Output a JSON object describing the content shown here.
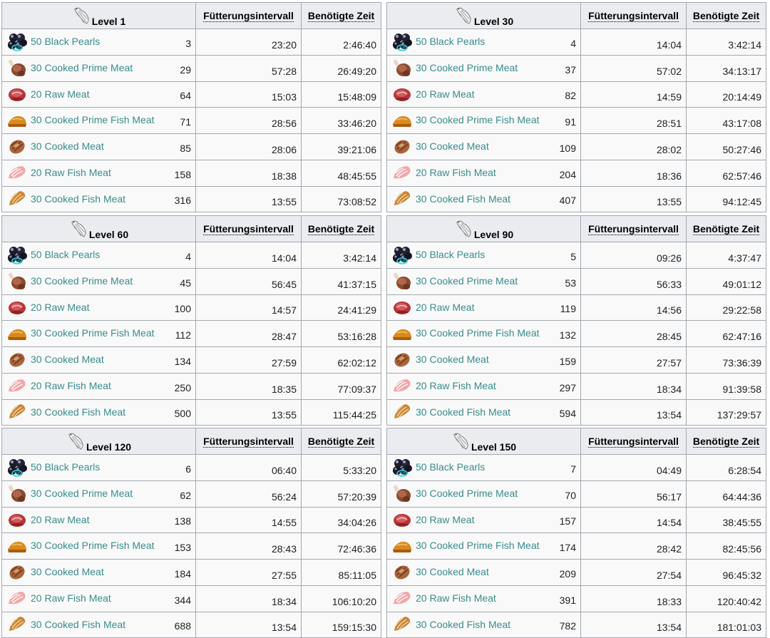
{
  "headers": {
    "interval": "Fütterungsintervall",
    "time": "Benötigte Zeit"
  },
  "tables": [
    {
      "level": "Level 1",
      "rows": [
        {
          "item": "50 Black Pearls",
          "icon": "black-pearls-icon",
          "qty": "3",
          "interval": "23:20",
          "time": "2:46:40"
        },
        {
          "item": "30 Cooked Prime Meat",
          "icon": "cooked-prime-meat-icon",
          "qty": "29",
          "interval": "57:28",
          "time": "26:49:20"
        },
        {
          "item": "20 Raw Meat",
          "icon": "raw-meat-icon",
          "qty": "64",
          "interval": "15:03",
          "time": "15:48:09"
        },
        {
          "item": "30 Cooked Prime Fish Meat",
          "icon": "cooked-prime-fish-meat-icon",
          "qty": "71",
          "interval": "28:56",
          "time": "33:46:20"
        },
        {
          "item": "30 Cooked Meat",
          "icon": "cooked-meat-icon",
          "qty": "85",
          "interval": "28:06",
          "time": "39:21:06"
        },
        {
          "item": "20 Raw Fish Meat",
          "icon": "raw-fish-meat-icon",
          "qty": "158",
          "interval": "18:38",
          "time": "48:45:55"
        },
        {
          "item": "30 Cooked Fish Meat",
          "icon": "cooked-fish-meat-icon",
          "qty": "316",
          "interval": "13:55",
          "time": "73:08:52"
        }
      ]
    },
    {
      "level": "Level 30",
      "rows": [
        {
          "item": "50 Black Pearls",
          "icon": "black-pearls-icon",
          "qty": "4",
          "interval": "14:04",
          "time": "3:42:14"
        },
        {
          "item": "30 Cooked Prime Meat",
          "icon": "cooked-prime-meat-icon",
          "qty": "37",
          "interval": "57:02",
          "time": "34:13:17"
        },
        {
          "item": "20 Raw Meat",
          "icon": "raw-meat-icon",
          "qty": "82",
          "interval": "14:59",
          "time": "20:14:49"
        },
        {
          "item": "30 Cooked Prime Fish Meat",
          "icon": "cooked-prime-fish-meat-icon",
          "qty": "91",
          "interval": "28:51",
          "time": "43:17:08"
        },
        {
          "item": "30 Cooked Meat",
          "icon": "cooked-meat-icon",
          "qty": "109",
          "interval": "28:02",
          "time": "50:27:46"
        },
        {
          "item": "20 Raw Fish Meat",
          "icon": "raw-fish-meat-icon",
          "qty": "204",
          "interval": "18:36",
          "time": "62:57:46"
        },
        {
          "item": "30 Cooked Fish Meat",
          "icon": "cooked-fish-meat-icon",
          "qty": "407",
          "interval": "13:55",
          "time": "94:12:45"
        }
      ]
    },
    {
      "level": "Level 60",
      "rows": [
        {
          "item": "50 Black Pearls",
          "icon": "black-pearls-icon",
          "qty": "4",
          "interval": "14:04",
          "time": "3:42:14"
        },
        {
          "item": "30 Cooked Prime Meat",
          "icon": "cooked-prime-meat-icon",
          "qty": "45",
          "interval": "56:45",
          "time": "41:37:15"
        },
        {
          "item": "20 Raw Meat",
          "icon": "raw-meat-icon",
          "qty": "100",
          "interval": "14:57",
          "time": "24:41:29"
        },
        {
          "item": "30 Cooked Prime Fish Meat",
          "icon": "cooked-prime-fish-meat-icon",
          "qty": "112",
          "interval": "28:47",
          "time": "53:16:28"
        },
        {
          "item": "30 Cooked Meat",
          "icon": "cooked-meat-icon",
          "qty": "134",
          "interval": "27:59",
          "time": "62:02:12"
        },
        {
          "item": "20 Raw Fish Meat",
          "icon": "raw-fish-meat-icon",
          "qty": "250",
          "interval": "18:35",
          "time": "77:09:37"
        },
        {
          "item": "30 Cooked Fish Meat",
          "icon": "cooked-fish-meat-icon",
          "qty": "500",
          "interval": "13:55",
          "time": "115:44:25"
        }
      ]
    },
    {
      "level": "Level 90",
      "rows": [
        {
          "item": "50 Black Pearls",
          "icon": "black-pearls-icon",
          "qty": "5",
          "interval": "09:26",
          "time": "4:37:47"
        },
        {
          "item": "30 Cooked Prime Meat",
          "icon": "cooked-prime-meat-icon",
          "qty": "53",
          "interval": "56:33",
          "time": "49:01:12"
        },
        {
          "item": "20 Raw Meat",
          "icon": "raw-meat-icon",
          "qty": "119",
          "interval": "14:56",
          "time": "29:22:58"
        },
        {
          "item": "30 Cooked Prime Fish Meat",
          "icon": "cooked-prime-fish-meat-icon",
          "qty": "132",
          "interval": "28:45",
          "time": "62:47:16"
        },
        {
          "item": "30 Cooked Meat",
          "icon": "cooked-meat-icon",
          "qty": "159",
          "interval": "27:57",
          "time": "73:36:39"
        },
        {
          "item": "20 Raw Fish Meat",
          "icon": "raw-fish-meat-icon",
          "qty": "297",
          "interval": "18:34",
          "time": "91:39:58"
        },
        {
          "item": "30 Cooked Fish Meat",
          "icon": "cooked-fish-meat-icon",
          "qty": "594",
          "interval": "13:54",
          "time": "137:29:57"
        }
      ]
    },
    {
      "level": "Level 120",
      "rows": [
        {
          "item": "50 Black Pearls",
          "icon": "black-pearls-icon",
          "qty": "6",
          "interval": "06:40",
          "time": "5:33:20"
        },
        {
          "item": "30 Cooked Prime Meat",
          "icon": "cooked-prime-meat-icon",
          "qty": "62",
          "interval": "56:24",
          "time": "57:20:39"
        },
        {
          "item": "20 Raw Meat",
          "icon": "raw-meat-icon",
          "qty": "138",
          "interval": "14:55",
          "time": "34:04:26"
        },
        {
          "item": "30 Cooked Prime Fish Meat",
          "icon": "cooked-prime-fish-meat-icon",
          "qty": "153",
          "interval": "28:43",
          "time": "72:46:36"
        },
        {
          "item": "30 Cooked Meat",
          "icon": "cooked-meat-icon",
          "qty": "184",
          "interval": "27:55",
          "time": "85:11:05"
        },
        {
          "item": "20 Raw Fish Meat",
          "icon": "raw-fish-meat-icon",
          "qty": "344",
          "interval": "18:34",
          "time": "106:10:20"
        },
        {
          "item": "30 Cooked Fish Meat",
          "icon": "cooked-fish-meat-icon",
          "qty": "688",
          "interval": "13:54",
          "time": "159:15:30"
        }
      ]
    },
    {
      "level": "Level 150",
      "rows": [
        {
          "item": "50 Black Pearls",
          "icon": "black-pearls-icon",
          "qty": "7",
          "interval": "04:49",
          "time": "6:28:54"
        },
        {
          "item": "30 Cooked Prime Meat",
          "icon": "cooked-prime-meat-icon",
          "qty": "70",
          "interval": "56:17",
          "time": "64:44:36"
        },
        {
          "item": "20 Raw Meat",
          "icon": "raw-meat-icon",
          "qty": "157",
          "interval": "14:54",
          "time": "38:45:55"
        },
        {
          "item": "30 Cooked Prime Fish Meat",
          "icon": "cooked-prime-fish-meat-icon",
          "qty": "174",
          "interval": "28:42",
          "time": "82:45:56"
        },
        {
          "item": "30 Cooked Meat",
          "icon": "cooked-meat-icon",
          "qty": "209",
          "interval": "27:54",
          "time": "96:45:32"
        },
        {
          "item": "20 Raw Fish Meat",
          "icon": "raw-fish-meat-icon",
          "qty": "391",
          "interval": "18:33",
          "time": "120:40:42"
        },
        {
          "item": "30 Cooked Fish Meat",
          "icon": "cooked-fish-meat-icon",
          "qty": "782",
          "interval": "13:54",
          "time": "181:01:03"
        }
      ]
    }
  ]
}
